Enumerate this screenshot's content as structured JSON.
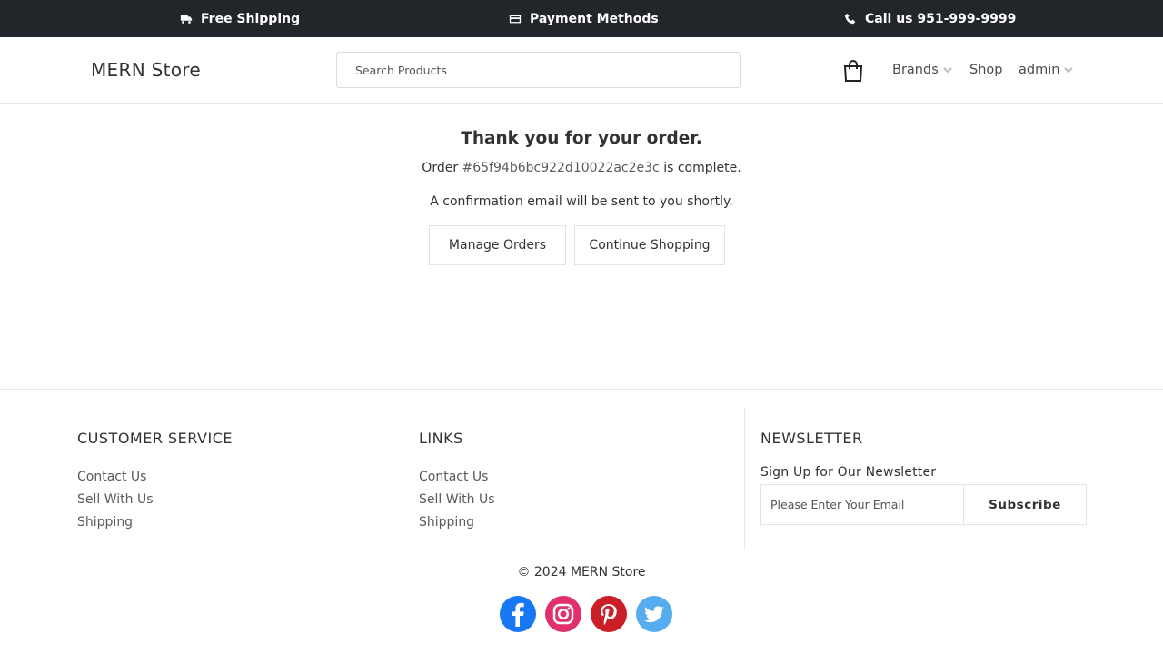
{
  "topbar": {
    "shipping": "Free Shipping",
    "payment": "Payment Methods",
    "phone": "Call us 951-999-9999"
  },
  "header": {
    "logo": "MERN Store",
    "search_placeholder": "Search Products",
    "nav": {
      "brands": "Brands",
      "shop": "Shop",
      "account": "admin"
    },
    "icons": [
      "shopping-bag-icon",
      "chevron-down-icon"
    ]
  },
  "main": {
    "title": "Thank you for your order.",
    "order_prefix": "Order",
    "order_id": "#65f94b6bc922d10022ac2e3c",
    "order_suffix": "is complete.",
    "confirm": "A confirmation email will be sent to you shortly.",
    "manage_button": "Manage Orders",
    "continue_button": "Continue Shopping"
  },
  "footer": {
    "customer_service": {
      "title": "CUSTOMER SERVICE",
      "links": [
        "Contact Us",
        "Sell With Us",
        "Shipping"
      ]
    },
    "links": {
      "title": "LINKS",
      "links": [
        "Contact Us",
        "Sell With Us",
        "Shipping"
      ]
    },
    "newsletter": {
      "title": "NEWSLETTER",
      "subtitle": "Sign Up for Our Newsletter",
      "placeholder": "Please Enter Your Email",
      "button": "Subscribe"
    },
    "copyright": "© 2024 MERN Store",
    "socials": [
      "facebook-icon",
      "instagram-icon",
      "pinterest-icon",
      "twitter-icon"
    ]
  },
  "colors": {
    "topbar_bg": "#22262a",
    "facebook": "#1877f2",
    "instagram": "#e1306c",
    "pinterest": "#cb1f27",
    "twitter": "#55acee"
  }
}
